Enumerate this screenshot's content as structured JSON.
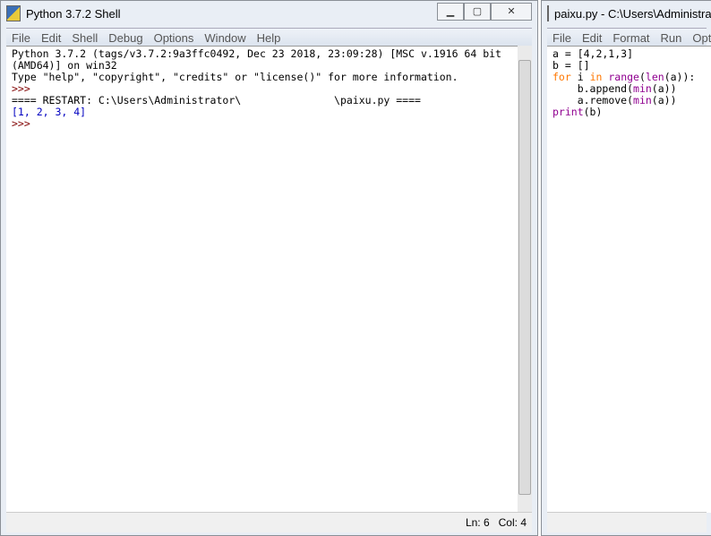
{
  "shell": {
    "title": "Python 3.7.2 Shell",
    "menu": [
      "File",
      "Edit",
      "Shell",
      "Debug",
      "Options",
      "Window",
      "Help"
    ],
    "lines": [
      "Python 3.7.2 (tags/v3.7.2:9a3ffc0492, Dec 23 2018, 23:09:28) [MSC v.1916 64 bit",
      "(AMD64)] on win32",
      "Type \"help\", \"copyright\", \"credits\" or \"license()\" for more information."
    ],
    "prompt": ">>>",
    "restart": "==== RESTART: C:\\Users\\Administrator\\               \\paixu.py ====",
    "output": "[1, 2, 3, 4]",
    "status": {
      "ln": "Ln: 6",
      "col": "Col: 4"
    }
  },
  "editor": {
    "title": "paixu.py - C:\\Users\\Administrator",
    "menu": [
      "File",
      "Edit",
      "Format",
      "Run",
      "Options"
    ],
    "code": {
      "l1": "a = [4,2,1,3]",
      "l2": "b = []",
      "kw_for": "for",
      "l3a": " i ",
      "kw_in": "in",
      "sp": " ",
      "range": "range",
      "p1": "(",
      "len": "len",
      "l3b": "(a)):",
      "indent": "    ",
      "append": "b.append(",
      "min": "min",
      "close": "(a))",
      "remove": "a.remove(",
      "print": "print",
      "pargs": "(b)"
    }
  },
  "colors": {
    "prompt": "#800000",
    "output": "#0000c0",
    "keyword": "#ff7700",
    "builtin": "#900090"
  }
}
